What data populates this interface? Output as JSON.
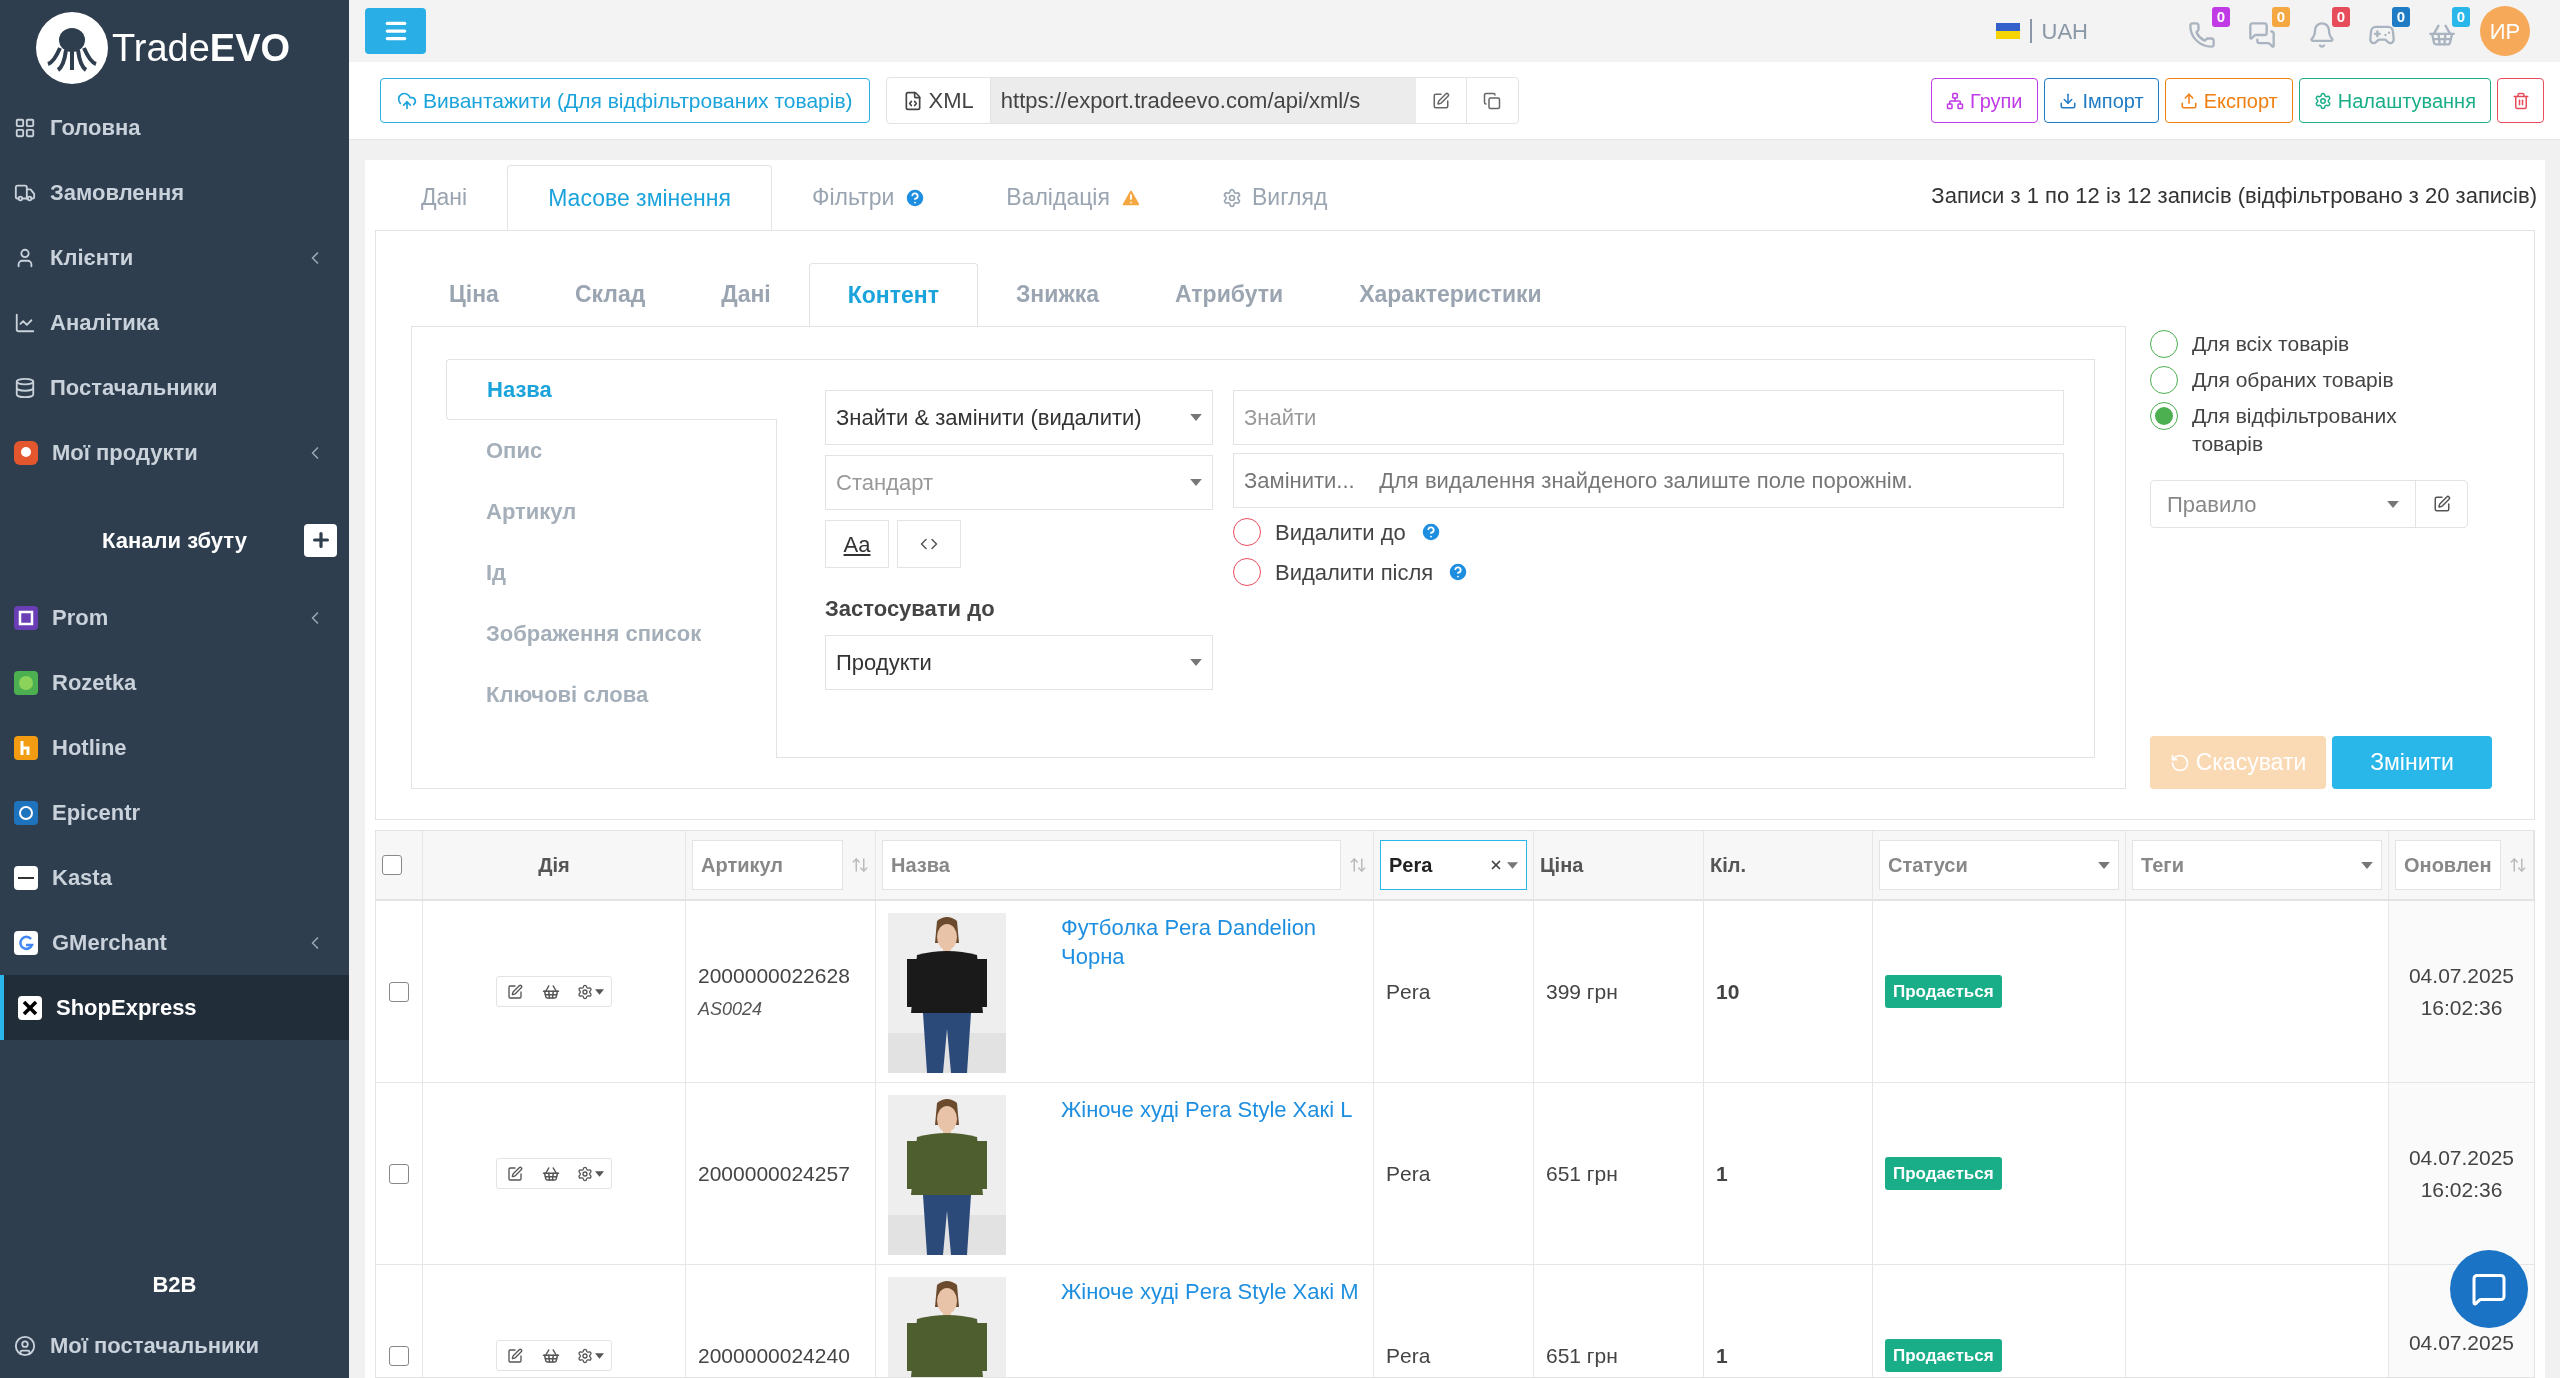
{
  "brand": {
    "light": "Trade",
    "bold": "EVO"
  },
  "sidebar": {
    "items": [
      {
        "label": "Головна",
        "expandable": false,
        "selected": false
      },
      {
        "label": "Замовлення",
        "expandable": false,
        "selected": false
      },
      {
        "label": "Клієнти",
        "expandable": true,
        "selected": false
      },
      {
        "label": "Аналітика",
        "expandable": false,
        "selected": false
      },
      {
        "label": "Постачальники",
        "expandable": false,
        "selected": false
      },
      {
        "label": "Мої продукти",
        "expandable": true,
        "selected": false
      }
    ],
    "channels_title": "Канали збуту",
    "channels": [
      {
        "label": "Prom",
        "expandable": true,
        "selected": false,
        "color": "#6a3fb5"
      },
      {
        "label": "Rozetka",
        "expandable": false,
        "selected": false,
        "color": "#4caf50"
      },
      {
        "label": "Hotline",
        "expandable": false,
        "selected": false,
        "color": "#f39c12"
      },
      {
        "label": "Epicentr",
        "expandable": false,
        "selected": false,
        "color": "#1e73be"
      },
      {
        "label": "Kasta",
        "expandable": false,
        "selected": false,
        "color": "#ffffff"
      },
      {
        "label": "GMerchant",
        "expandable": true,
        "selected": false,
        "color": "#ffffff"
      },
      {
        "label": "ShopExpress",
        "expandable": false,
        "selected": true,
        "color": "#ffffff"
      }
    ],
    "b2b_title": "B2B",
    "b2b_items": [
      {
        "label": "Мої постачальники",
        "expandable": false,
        "selected": false
      }
    ]
  },
  "header": {
    "currency": "UAH",
    "notifications": [
      {
        "count": "0",
        "color": "#c03ae6"
      },
      {
        "count": "0",
        "color": "#f5a742"
      },
      {
        "count": "0",
        "color": "#e74c5a"
      },
      {
        "count": "0",
        "color": "#1e7bc4"
      },
      {
        "count": "0",
        "color": "#29b6e8"
      }
    ],
    "avatar": "ИР"
  },
  "toolbar": {
    "upload_button": "Вивантажити (Для відфільтрованих товарів)",
    "xml_label": "XML",
    "xml_url": "https://export.tradeevo.com/api/xml/s",
    "buttons": [
      {
        "label": "Групи",
        "color": "#c03ae6"
      },
      {
        "label": "Імпорт",
        "color": "#1e7bc4"
      },
      {
        "label": "Експорт",
        "color": "#f07f12"
      },
      {
        "label": "Налаштування",
        "color": "#1aae88"
      }
    ]
  },
  "main_tabs": [
    {
      "label": "Дані",
      "selected": false
    },
    {
      "label": "Масове змінення",
      "selected": true
    },
    {
      "label": "Фільтри",
      "selected": false
    },
    {
      "label": "Валідація",
      "selected": false
    },
    {
      "label": "Вигляд",
      "selected": false
    }
  ],
  "records_info": "Записи з 1 по 12 із 12 записів (відфільтровано з 20 записів)",
  "sub_tabs": [
    {
      "label": "Ціна",
      "selected": false
    },
    {
      "label": "Склад",
      "selected": false
    },
    {
      "label": "Дані",
      "selected": false
    },
    {
      "label": "Контент",
      "selected": true
    },
    {
      "label": "Знижка",
      "selected": false
    },
    {
      "label": "Атрибути",
      "selected": false
    },
    {
      "label": "Характеристики",
      "selected": false
    }
  ],
  "fields": [
    {
      "label": "Назва",
      "selected": true
    },
    {
      "label": "Опис",
      "selected": false
    },
    {
      "label": "Артикул",
      "selected": false
    },
    {
      "label": "Ід",
      "selected": false
    },
    {
      "label": "Зображення список",
      "selected": false
    },
    {
      "label": "Ключові слова",
      "selected": false
    }
  ],
  "form": {
    "operation": "Знайти & замінити (видалити)",
    "mode_placeholder": "Стандарт",
    "case_button": "Aa",
    "apply_label": "Застосувати до",
    "apply_value": "Продукти",
    "find_placeholder": "Знайти",
    "replace_placeholder": "Замінити...    Для видалення знайденого залиште поле порожнім.",
    "options": [
      {
        "label": "Видалити до",
        "checked": false
      },
      {
        "label": "Видалити після",
        "checked": false
      }
    ]
  },
  "scope": {
    "options": [
      {
        "label": "Для всіх товарів",
        "selected": false
      },
      {
        "label": "Для обраних товарів",
        "selected": false
      },
      {
        "label": "Для відфільтрованих товарів",
        "selected": true
      }
    ],
    "rule_placeholder": "Правило",
    "cancel_button": "Скасувати",
    "cancel_disabled": true,
    "apply_button": "Змінити"
  },
  "table": {
    "columns": [
      {
        "kind": "checkbox",
        "checked": false
      },
      {
        "kind": "plain",
        "label": "Дія"
      },
      {
        "kind": "input",
        "placeholder": "Артикул",
        "sortable": true
      },
      {
        "kind": "input",
        "placeholder": "Назва",
        "sortable": true
      },
      {
        "kind": "filter",
        "value": "Pera"
      },
      {
        "kind": "plain",
        "label": "Ціна"
      },
      {
        "kind": "plain",
        "label": "Кіл."
      },
      {
        "kind": "select",
        "placeholder": "Статуси"
      },
      {
        "kind": "select",
        "placeholder": "Теги"
      },
      {
        "kind": "input",
        "placeholder": "Оновлен",
        "sortable": true
      }
    ],
    "rows": [
      {
        "checked": false,
        "sku": "2000000022628",
        "code": "AS0024",
        "name": "Футболка Pera Dandelion Чорна",
        "brand": "Pera",
        "price": "399 грн",
        "qty": "10",
        "status": "Продається",
        "date": "04.07.2025",
        "time": "16:02:36"
      },
      {
        "checked": false,
        "sku": "2000000024257",
        "name": "Жіноче худі Pera Style Хакі L",
        "brand": "Pera",
        "price": "651 грн",
        "qty": "1",
        "status": "Продається",
        "date": "04.07.2025",
        "time": "16:02:36"
      },
      {
        "checked": false,
        "sku": "2000000024240",
        "name": "Жіноче худі Pera Style Хакі M",
        "brand": "Pera",
        "price": "651 грн",
        "qty": "1",
        "status": "Продається",
        "date": "04.07.2025"
      }
    ]
  }
}
